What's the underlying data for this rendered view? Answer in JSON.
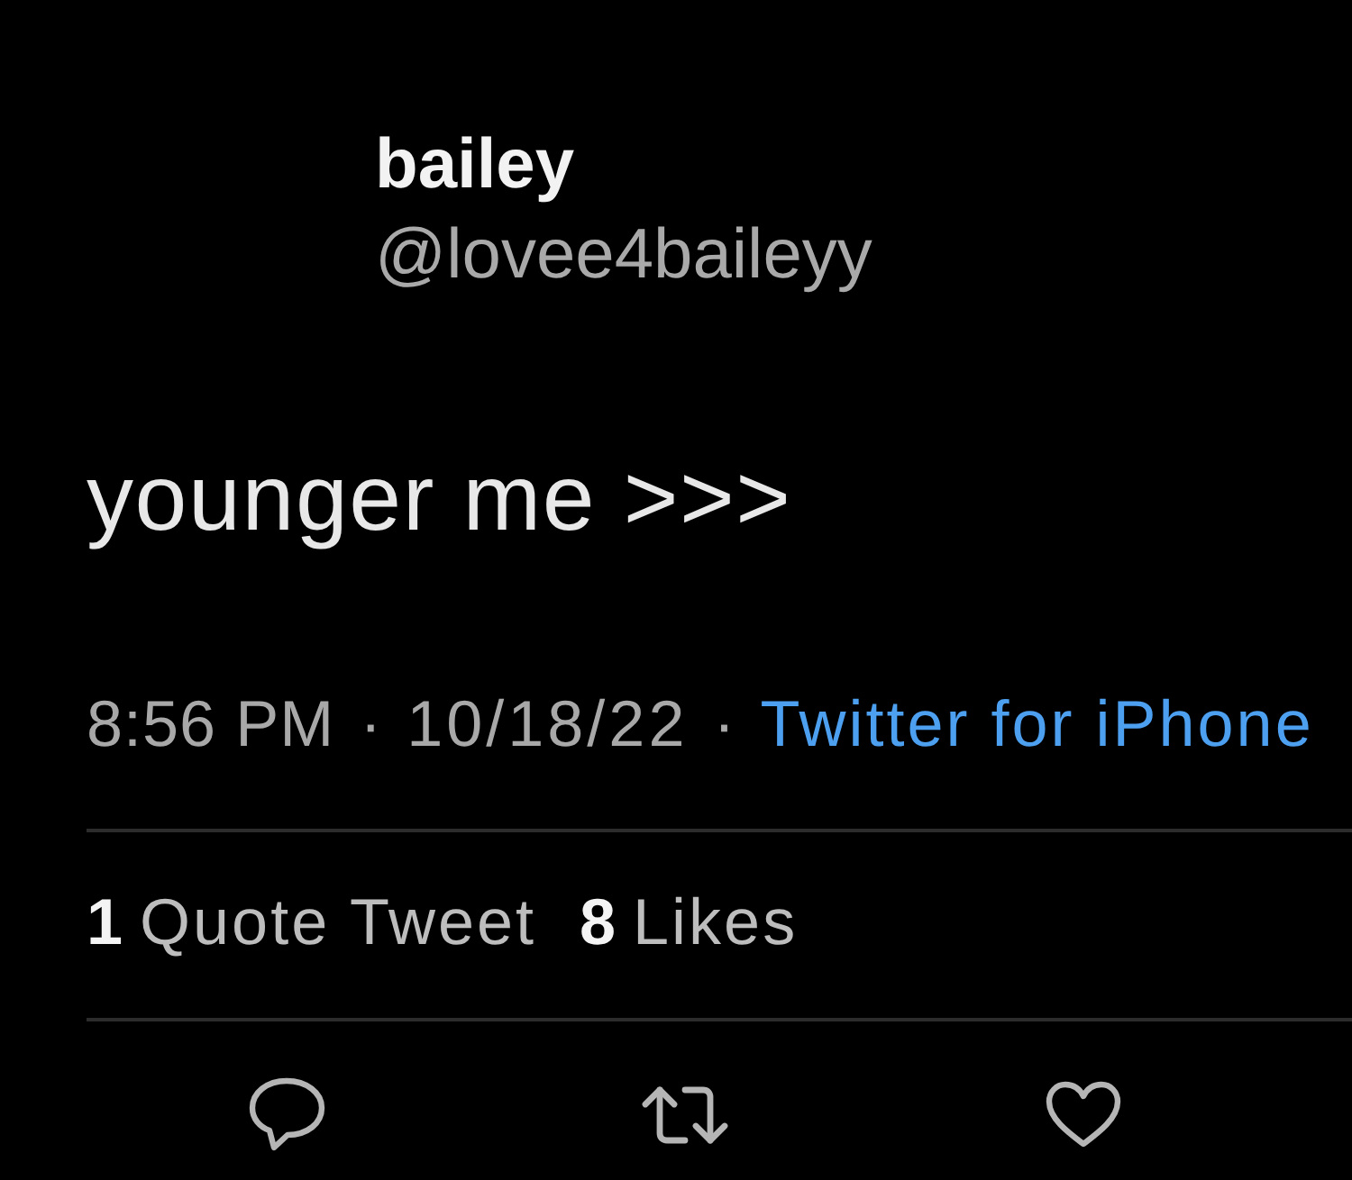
{
  "author": {
    "name": "bailey",
    "handle": "@lovee4baileyy"
  },
  "tweet": {
    "text": "younger me >>>"
  },
  "meta": [
    {
      "kind": "time",
      "text": "8:56 PM"
    },
    {
      "kind": "dot",
      "text": "·"
    },
    {
      "kind": "date",
      "text": "10/18/22"
    },
    {
      "kind": "dot",
      "text": "·"
    },
    {
      "kind": "link",
      "text": "Twitter for iPhone"
    }
  ],
  "stats": [
    {
      "count": "1",
      "label": "Quote Tweet"
    },
    {
      "count": "8",
      "label": "Likes"
    }
  ]
}
